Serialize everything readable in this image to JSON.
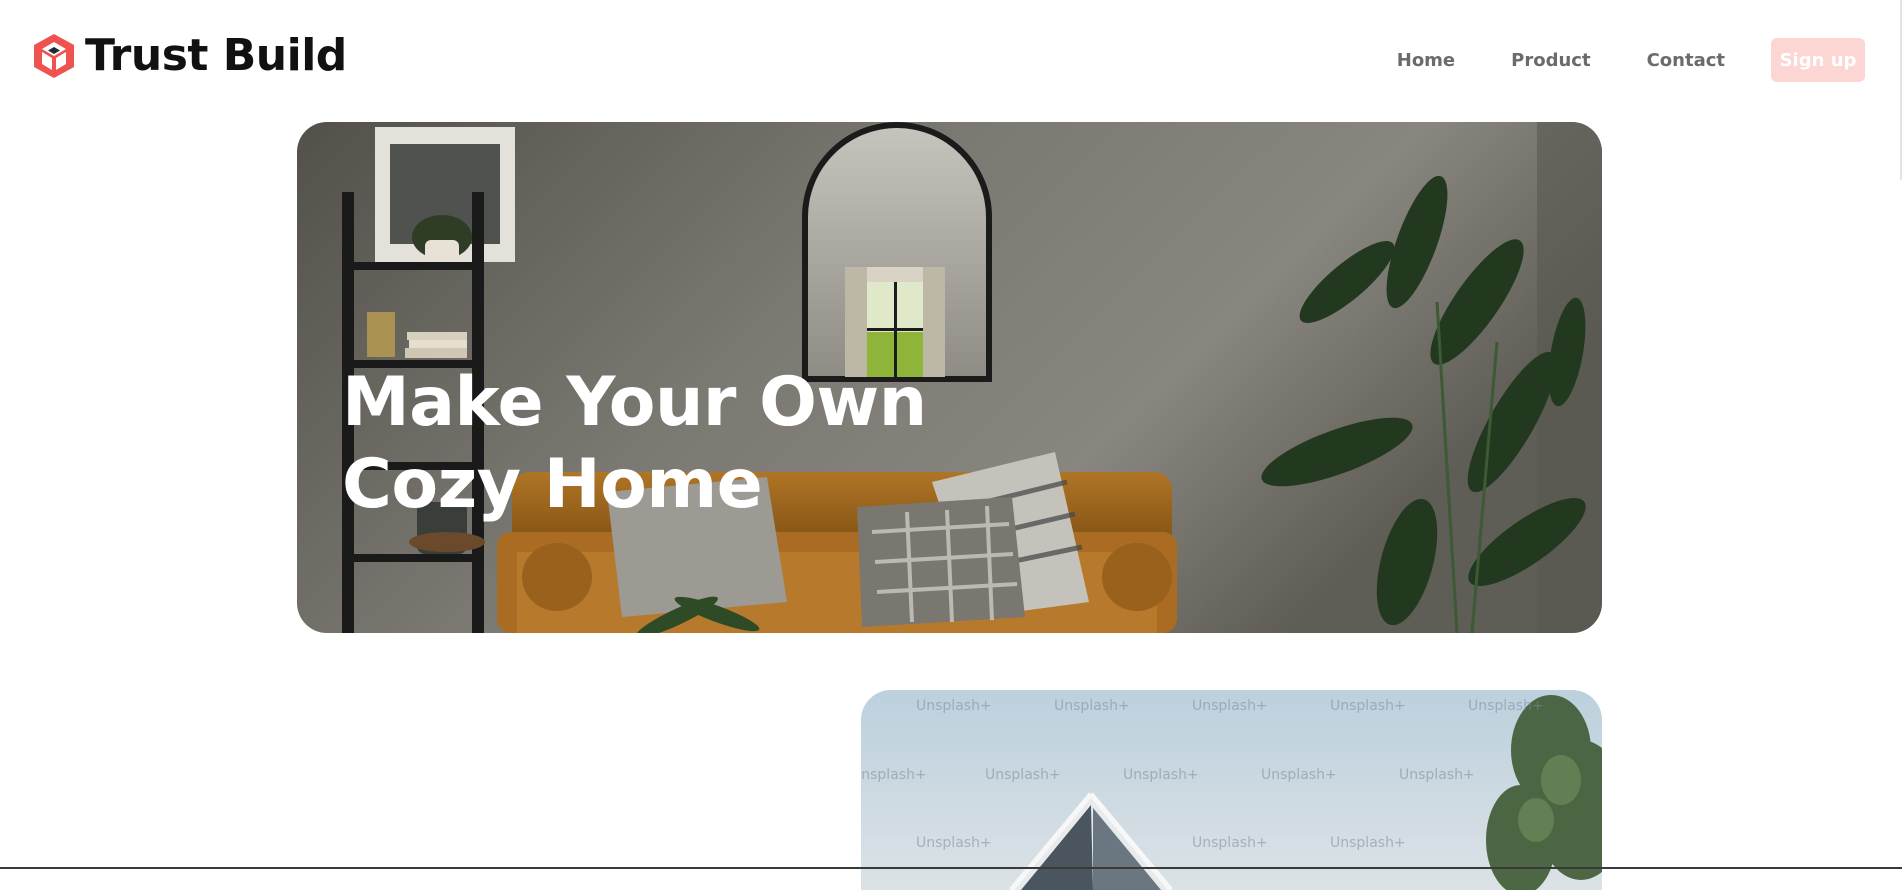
{
  "header": {
    "brand": "Trust Build",
    "logo_icon": "cube-logo-icon",
    "accent_color": "#ef5350",
    "nav": [
      "Home",
      "Product",
      "Contact"
    ],
    "signup_label": "Sign up",
    "signup_color": "#fbd6d3"
  },
  "hero": {
    "title_line1": "Make Your Own",
    "title_line2": "Cozy Home"
  },
  "building_card": {
    "watermark": "Unsplash+"
  }
}
